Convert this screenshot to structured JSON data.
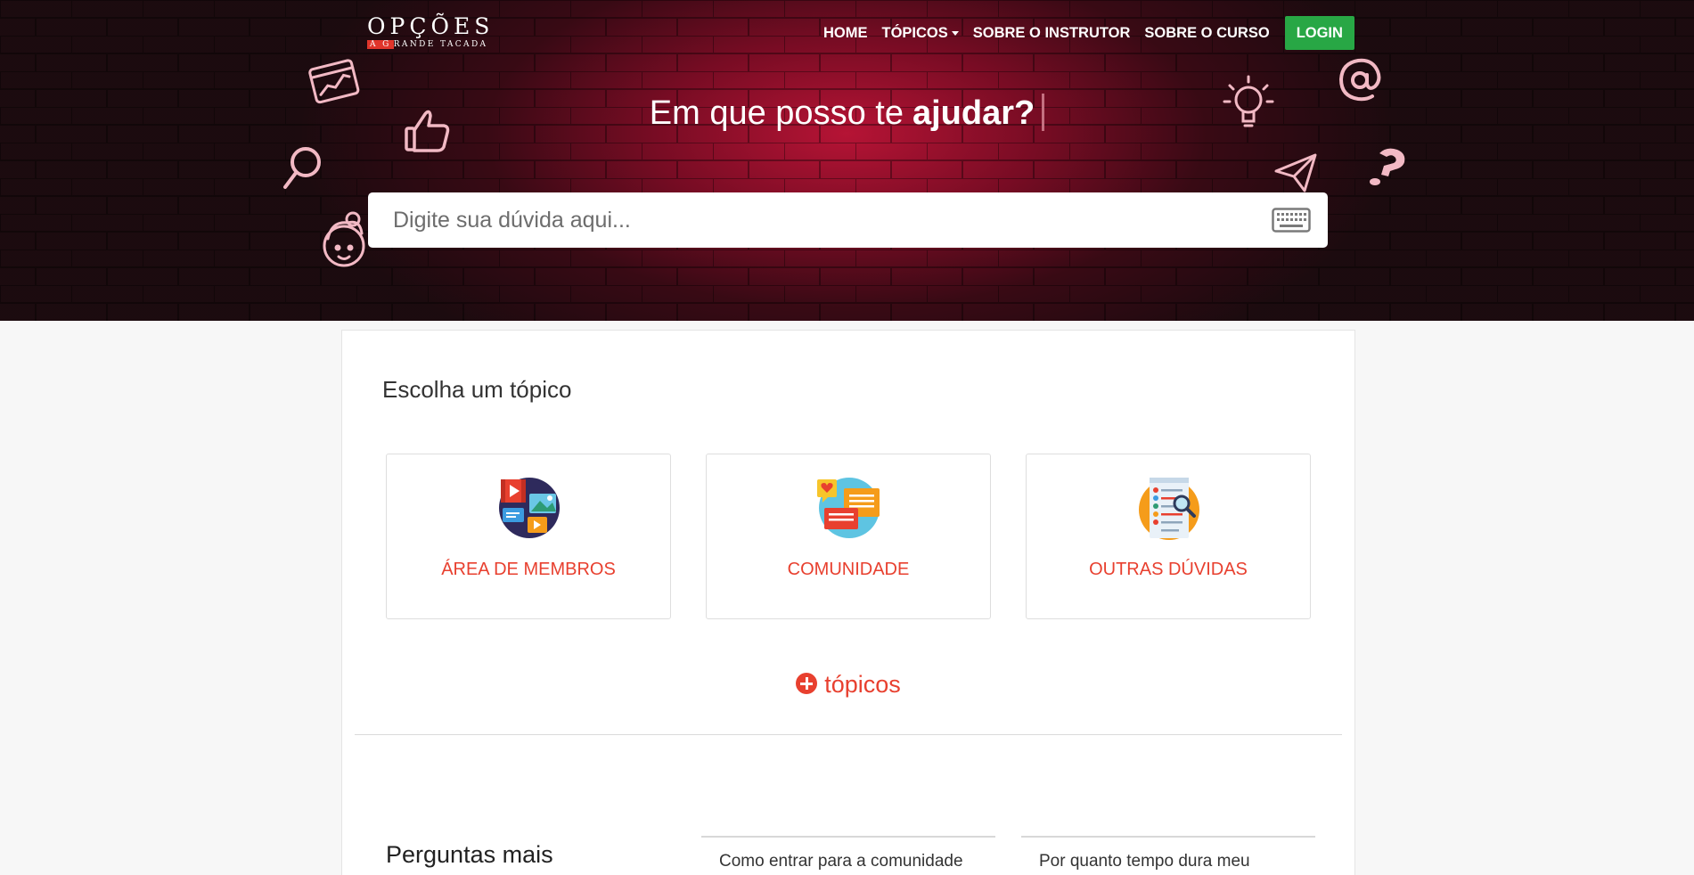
{
  "header": {
    "logo_title": "OPÇÕES",
    "logo_sub_highlight": "A G",
    "logo_sub_rest": "RANDE TACADA",
    "nav": {
      "home": "HOME",
      "topics": "TÓPICOS",
      "about_instructor": "SOBRE O INSTRUTOR",
      "about_course": "SOBRE O CURSO",
      "login": "LOGIN"
    }
  },
  "hero": {
    "headline_prefix": "Em que posso te",
    "headline_bold": "ajudar?",
    "search_placeholder": "Digite sua dúvida aqui..."
  },
  "main": {
    "section_title": "Escolha um tópico",
    "topics": [
      {
        "label": "ÁREA DE MEMBROS",
        "icon": "media-gallery-icon"
      },
      {
        "label": "COMUNIDADE",
        "icon": "chat-bubbles-icon"
      },
      {
        "label": "OUTRAS DÚVIDAS",
        "icon": "document-search-icon"
      }
    ],
    "more_topics": "tópicos",
    "faq_title": "Perguntas mais",
    "faq_items": [
      "Como entrar para a comunidade",
      "Por quanto tempo dura meu"
    ]
  },
  "colors": {
    "accent": "#e8402f",
    "login_green": "#28a745",
    "hero_red": "#b3123a",
    "hero_dark": "#1c0c10"
  }
}
